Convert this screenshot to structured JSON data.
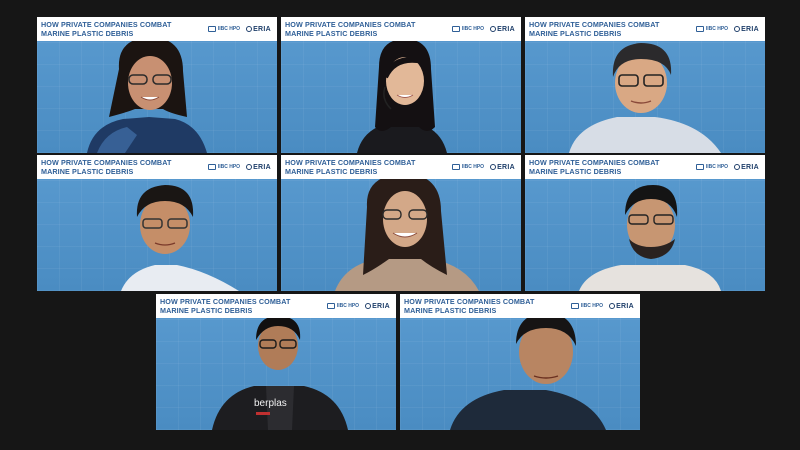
{
  "meeting": {
    "banner_title": "HOW PRIVATE COMPANIES COMBAT\nMARINE PLASTIC DEBRIS",
    "logo_left": "IIBC HPO",
    "logo_right": "ERIA"
  },
  "participants": [
    {
      "shirt_text": ""
    },
    {
      "shirt_text": ""
    },
    {
      "shirt_text": ""
    },
    {
      "shirt_text": ""
    },
    {
      "shirt_text": ""
    },
    {
      "shirt_text": ""
    },
    {
      "shirt_text": "berplas"
    },
    {
      "shirt_text": ""
    }
  ],
  "colors": {
    "background": "#161616",
    "banner_text": "#2f5f97",
    "tile_blue": "#4f93c8",
    "active_speaker": "#7ec84a"
  }
}
